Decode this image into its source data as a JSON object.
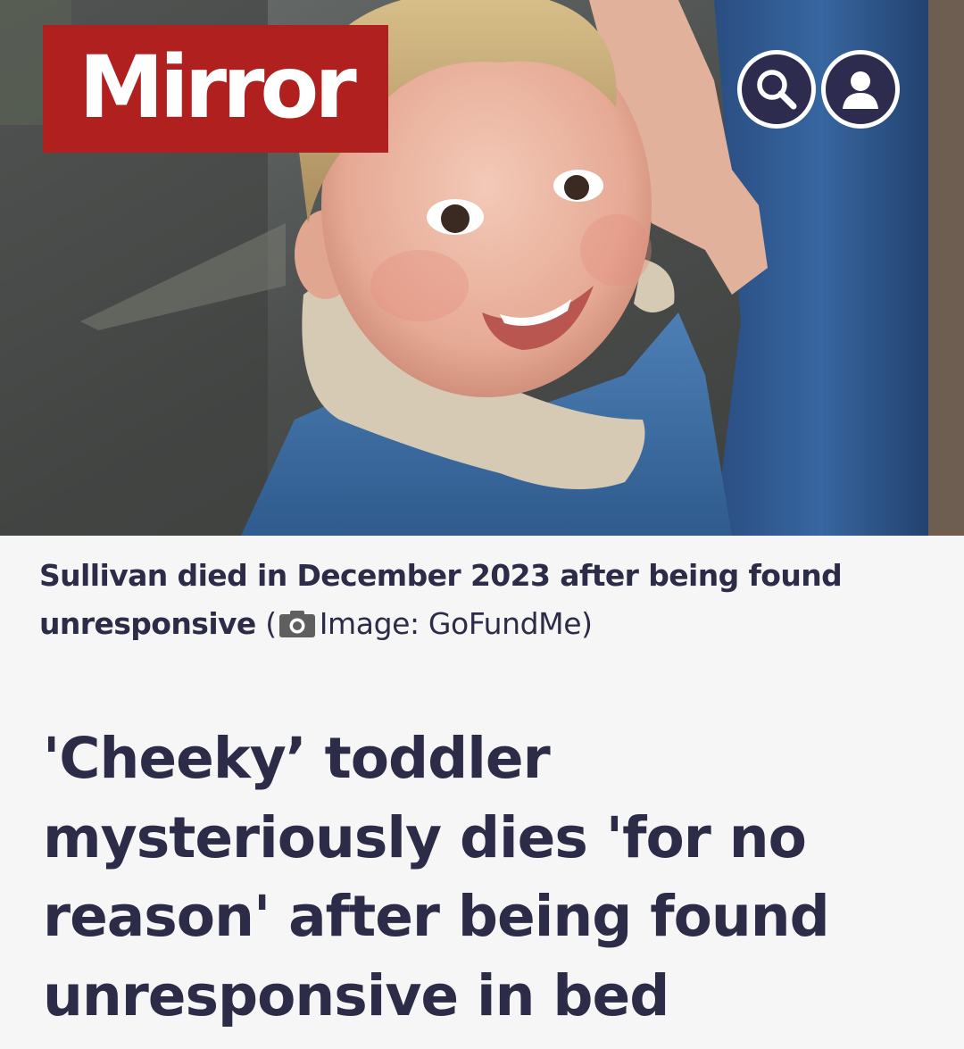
{
  "brand": {
    "logo_text": "Mirror",
    "logo_color": "#b0201e"
  },
  "header": {
    "search_icon": "search-icon",
    "account_icon": "user-icon",
    "button_color": "#2d2c4f"
  },
  "hero_image": {
    "caption": "Sullivan died in December 2023 after being found unresponsive",
    "credit_open": "(",
    "credit_icon": "camera-icon",
    "credit_text": "Image: GoFundMe)"
  },
  "article": {
    "headline": "'Cheeky’ toddler mysteriously dies 'for no reason' after being found unresponsive in bed"
  },
  "colors": {
    "text": "#2d2c48",
    "background": "#f5f6f5"
  }
}
